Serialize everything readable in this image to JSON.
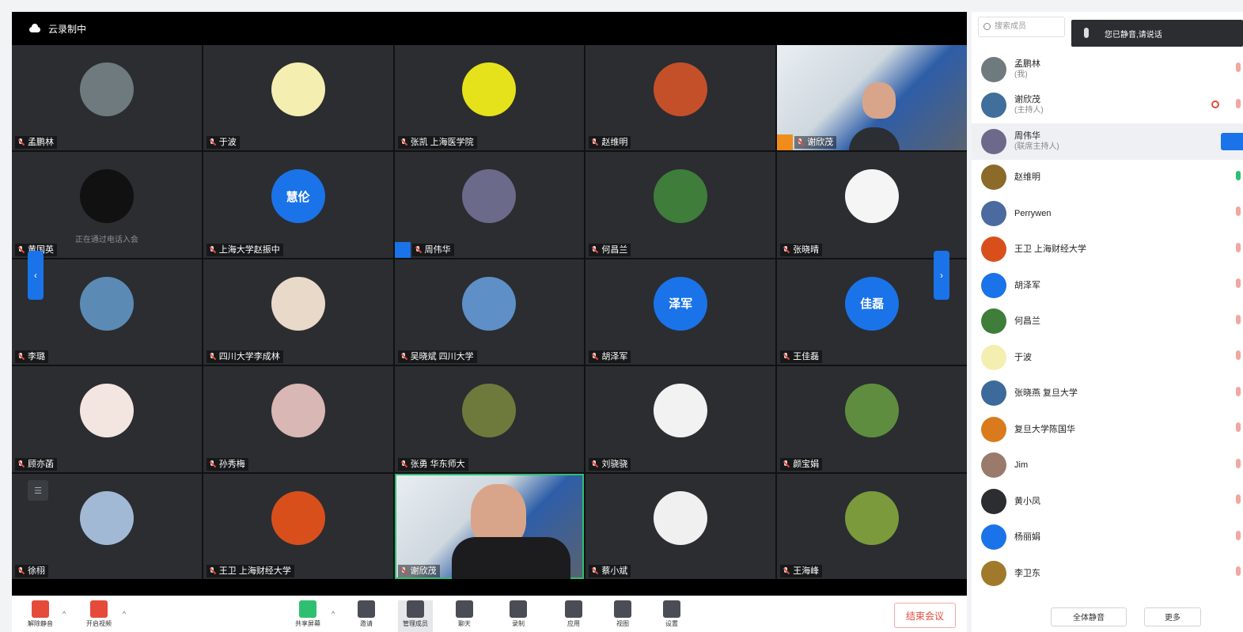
{
  "meeting": {
    "title": "云录制中"
  },
  "grid": {
    "tiles": [
      {
        "name": "孟鹏林",
        "avatar_color": "#6f7a7f",
        "avatar_text": ""
      },
      {
        "name": "于波",
        "avatar_color": "#f4efb0",
        "avatar_text": ""
      },
      {
        "name": "张凯 上海医学院",
        "avatar_color": "#e5e21b",
        "avatar_text": ""
      },
      {
        "name": "赵维明",
        "avatar_color": "#c4502a",
        "avatar_text": ""
      },
      {
        "name": "谢欣茂",
        "video": true,
        "host": true
      },
      {
        "name": "黄国英",
        "avatar_color": "#111111",
        "avatar_text": "",
        "sub": "正在通过电话入会"
      },
      {
        "name": "上海大学赵振中",
        "avatar_color": "#1a73e8",
        "avatar_text": "慧伦"
      },
      {
        "name": "周伟华",
        "avatar_color": "#6b6a8a",
        "avatar_text": "",
        "cohost": true
      },
      {
        "name": "何昌兰",
        "avatar_color": "#3e7d3a",
        "avatar_text": ""
      },
      {
        "name": "张晓晴",
        "avatar_color": "#f5f5f5",
        "avatar_text": ""
      },
      {
        "name": "李璐",
        "avatar_color": "#5b8bb5",
        "avatar_text": ""
      },
      {
        "name": "四川大学李成林",
        "avatar_color": "#e8d9c9",
        "avatar_text": ""
      },
      {
        "name": "吴晓斌 四川大学",
        "avatar_color": "#5e8fc7",
        "avatar_text": ""
      },
      {
        "name": "胡泽军",
        "avatar_color": "#1a73e8",
        "avatar_text": "泽军"
      },
      {
        "name": "王佳磊",
        "avatar_color": "#1a73e8",
        "avatar_text": "佳磊"
      },
      {
        "name": "顾亦菡",
        "avatar_color": "#f3e6e0",
        "avatar_text": ""
      },
      {
        "name": "孙秀梅",
        "avatar_color": "#d9b7b5",
        "avatar_text": ""
      },
      {
        "name": "张勇 华东师大",
        "avatar_color": "#6e7a3b",
        "avatar_text": ""
      },
      {
        "name": "刘骁骁",
        "avatar_color": "#f2f2f2",
        "avatar_text": ""
      },
      {
        "name": "颜宝娟",
        "avatar_color": "#5f8d3f",
        "avatar_text": ""
      },
      {
        "name": "徐栩",
        "avatar_color": "#a2b9d6",
        "avatar_text": ""
      },
      {
        "name": "王卫 上海财经大学",
        "avatar_color": "#d94f1c",
        "avatar_text": ""
      },
      {
        "name": "谢欣茂",
        "video": true,
        "big": true,
        "active": true
      },
      {
        "name": "蔡小斌",
        "avatar_color": "#f0f0f0",
        "avatar_text": ""
      },
      {
        "name": "王海峰",
        "avatar_color": "#7b9a3c",
        "avatar_text": ""
      }
    ],
    "grid_side_label": "☰",
    "nav_left_label": "‹",
    "nav_right_label": "›"
  },
  "toolbar": {
    "buttons": [
      {
        "label": "解除静音"
      },
      {
        "label": "开启视频"
      },
      {
        "label": "共享屏幕"
      },
      {
        "label": "邀请"
      },
      {
        "label": "管理成员"
      },
      {
        "label": "聊天"
      },
      {
        "label": "录制"
      },
      {
        "label": "应用"
      },
      {
        "label": "视图"
      },
      {
        "label": "设置"
      }
    ],
    "end_label": "结束会议"
  },
  "panel": {
    "search_placeholder": "搜索成员",
    "toast_text": "您已静音,请说话",
    "members": [
      {
        "name": "孟鹏林",
        "sub": "(我)",
        "color": "#6f7a7f"
      },
      {
        "name": "谢欣茂",
        "sub": "(主持人)",
        "color": "#3f6f9a"
      },
      {
        "name": "周伟华",
        "sub": "(联席主持人)",
        "color": "#6b6a8a",
        "selected": true
      },
      {
        "name": "赵维明",
        "sub": "",
        "color": "#8b6a2a",
        "mic_on": true
      },
      {
        "name": "Perrywen",
        "sub": "",
        "color": "#4a6aa0"
      },
      {
        "name": "王卫 上海财经大学",
        "sub": "",
        "color": "#d94f1c"
      },
      {
        "name": "胡泽军",
        "sub": "",
        "color": "#1a73e8"
      },
      {
        "name": "何昌兰",
        "sub": "",
        "color": "#3e7d3a"
      },
      {
        "name": "于波",
        "sub": "",
        "color": "#f4efb0"
      },
      {
        "name": "张晓燕 复旦大学",
        "sub": "",
        "color": "#3c6a9a"
      },
      {
        "name": "复旦大学陈国华",
        "sub": "",
        "color": "#d97b1c"
      },
      {
        "name": "Jim",
        "sub": "",
        "color": "#9a7a6a"
      },
      {
        "name": "黄小凤",
        "sub": "",
        "color": "#2b2d31"
      },
      {
        "name": "杨丽娟",
        "sub": "",
        "color": "#1a73e8"
      },
      {
        "name": "李卫东",
        "sub": "",
        "color": "#a07a2a"
      }
    ],
    "footer_buttons": [
      "全体静音",
      "更多"
    ]
  }
}
